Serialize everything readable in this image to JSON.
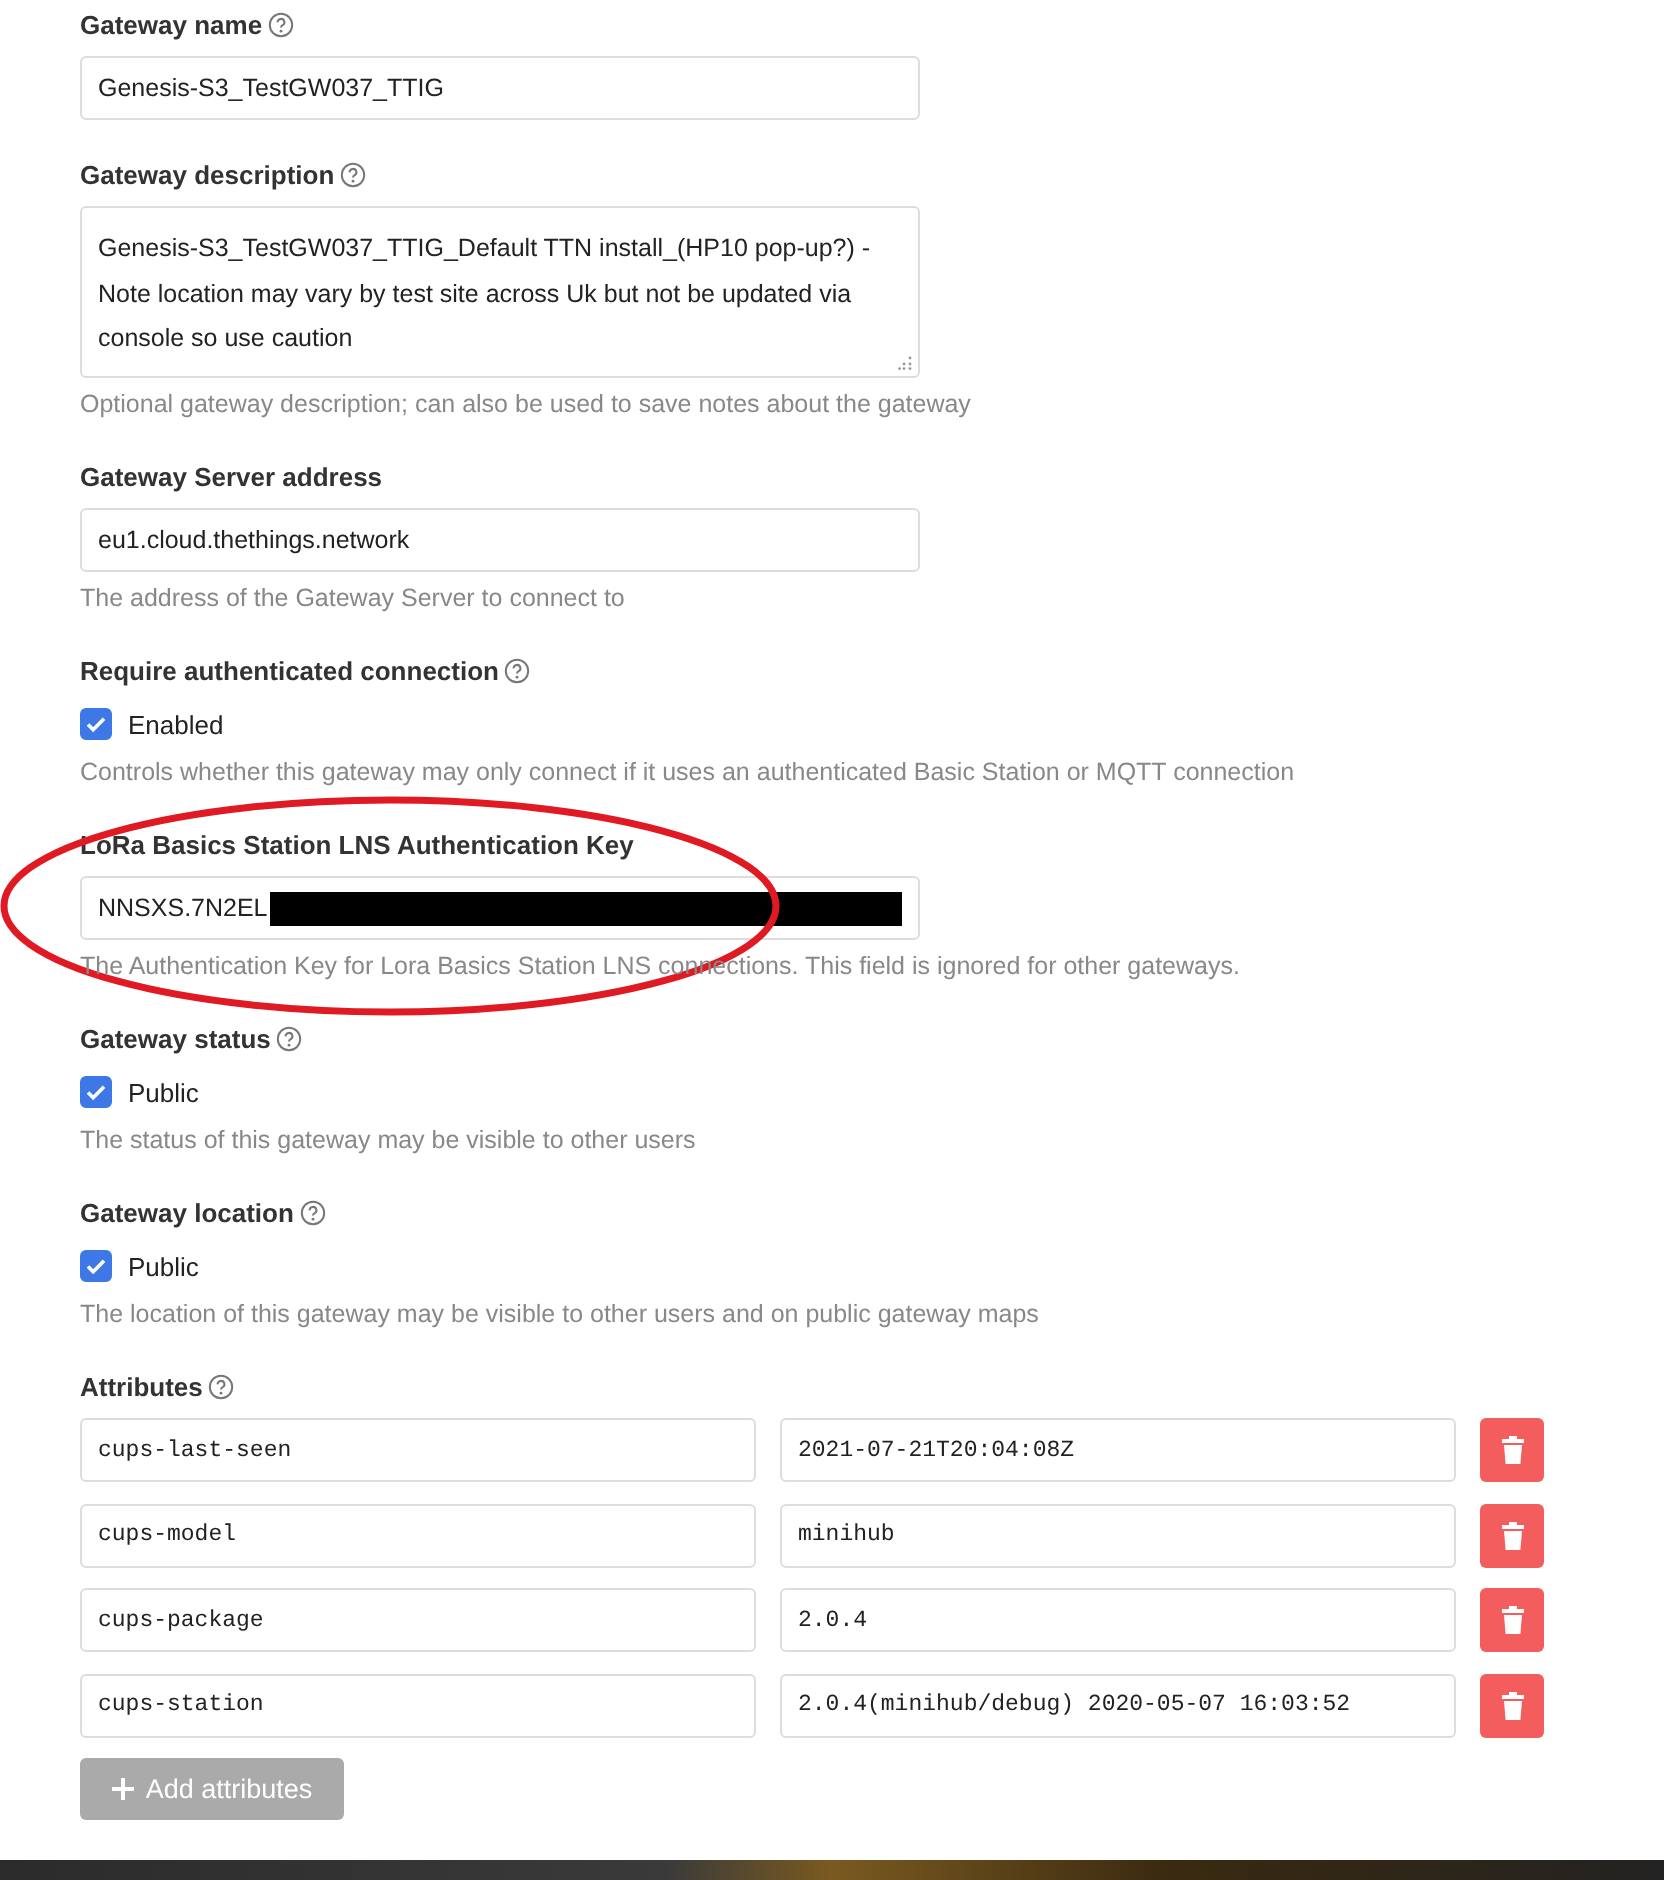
{
  "fields": [
    {
      "kind": "text",
      "label": "Gateway name",
      "help": true,
      "value": "Genesis-S3_TestGW037_TTIG"
    },
    {
      "kind": "textarea",
      "label": "Gateway description",
      "help": true,
      "value": "Genesis-S3_TestGW037_TTIG_Default TTN install_(HP10 pop-up?) - Note location may vary by test site across Uk but not be updated via console so use caution",
      "hint": "Optional gateway description; can also be used to save notes about the gateway"
    },
    {
      "kind": "text",
      "label": "Gateway Server address",
      "value": "eu1.cloud.thethings.network",
      "hint": "The address of the Gateway Server to connect to"
    },
    {
      "kind": "checkbox",
      "label": "Require authenticated connection",
      "help": true,
      "checked": true,
      "option": "Enabled",
      "hint": "Controls whether this gateway may only connect if it uses an authenticated Basic Station or MQTT connection"
    },
    {
      "kind": "text",
      "label": "LoRa Basics Station LNS Authentication Key",
      "value": "NNSXS.7N2EL",
      "redacted": true,
      "circled": true,
      "hint": "The Authentication Key for Lora Basics Station LNS connections. This field is ignored for other gateways."
    },
    {
      "kind": "checkbox",
      "label": "Gateway status",
      "help": true,
      "checked": true,
      "option": "Public",
      "hint": "The status of this gateway may be visible to other users"
    },
    {
      "kind": "checkbox",
      "label": "Gateway location",
      "help": true,
      "checked": true,
      "option": "Public",
      "hint": "The location of this gateway may be visible to other users and on public gateway maps"
    }
  ],
  "attributes": {
    "label": "Attributes",
    "help": true,
    "rows": [
      {
        "key": "cups-last-seen",
        "value": "2021-07-21T20:04:08Z"
      },
      {
        "key": "cups-model",
        "value": "minihub"
      },
      {
        "key": "cups-package",
        "value": "2.0.4"
      },
      {
        "key": "cups-station",
        "value": "2.0.4(minihub/debug) 2020-05-07 16:03:52"
      }
    ],
    "add_button": "Add attributes",
    "add_disabled": true
  }
}
